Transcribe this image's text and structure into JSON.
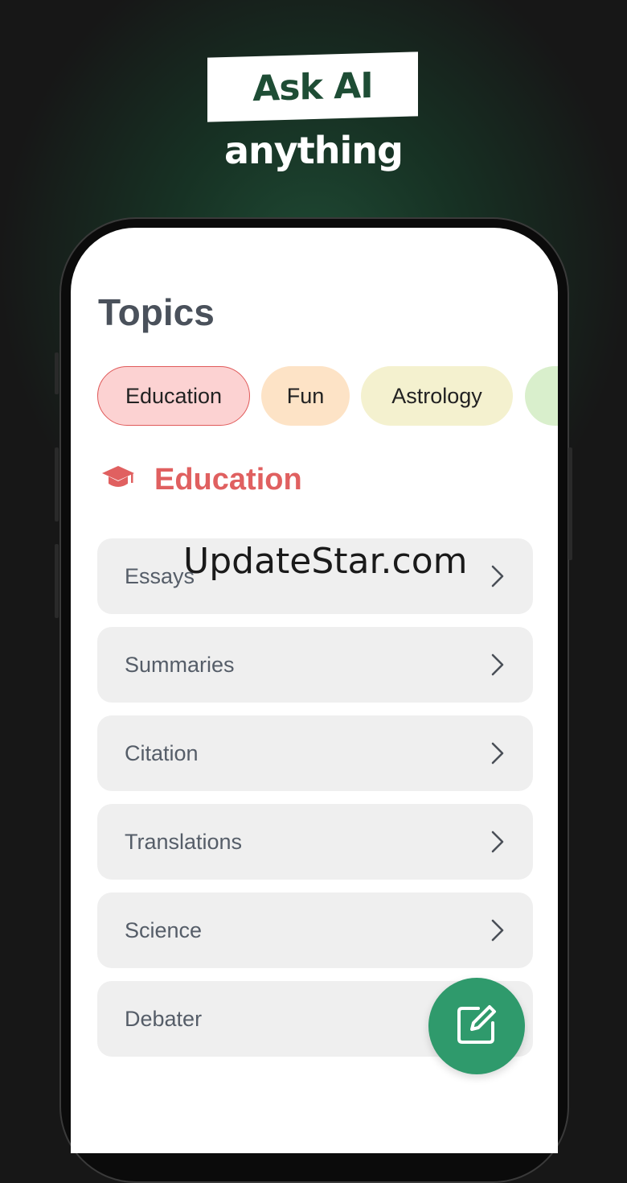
{
  "promo": {
    "headline": "Ask AI",
    "subheadline": "anything"
  },
  "screen": {
    "title": "Topics",
    "chips": [
      {
        "label": "Education",
        "selected": true,
        "bg": "#fcd2d2",
        "border": "#e05a5a"
      },
      {
        "label": "Fun",
        "selected": false,
        "bg": "#fde3c6"
      },
      {
        "label": "Astrology",
        "selected": false,
        "bg": "#f4f1cf"
      },
      {
        "label": "",
        "selected": false,
        "bg": "#d9efcc"
      }
    ],
    "section": {
      "icon": "graduation-cap-icon",
      "title": "Education",
      "color": "#e06060"
    },
    "items": [
      {
        "label": "Essays"
      },
      {
        "label": "Summaries"
      },
      {
        "label": "Citation"
      },
      {
        "label": "Translations"
      },
      {
        "label": "Science"
      },
      {
        "label": "Debater"
      }
    ],
    "fab": {
      "icon": "compose-icon",
      "color": "#2f9a6c"
    }
  },
  "watermark": "UpdateStar.com"
}
